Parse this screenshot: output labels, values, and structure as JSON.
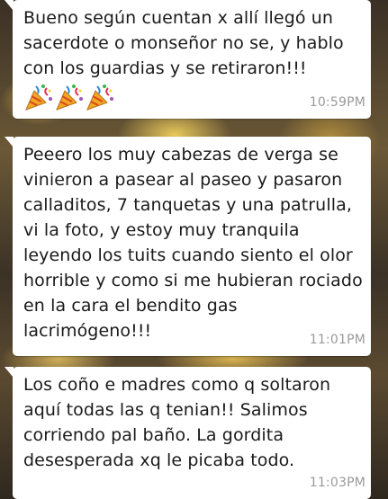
{
  "messages": [
    {
      "text": "Bueno según cuentan x allí llegó un sacerdote o monseñor no se, y hablo con los guardias y se retiraron!!!",
      "emojis": [
        "party-popper-icon",
        "party-popper-icon",
        "party-popper-icon"
      ],
      "time": "10:59PM"
    },
    {
      "text": "Peeero los muy cabezas de verga se vinieron a pasear al paseo y pasaron calladitos, 7 tanquetas y una patrulla, vi la foto, y estoy muy tranquila leyendo los tuits cuando siento el olor horrible y como si me hubieran rociado en la cara el bendito gas lacrimógeno!!!",
      "time": "11:01PM"
    },
    {
      "text": "Los coño e madres como q soltaron aquí todas las q tenian!! Salimos corriendo pal baño. La gordita desesperada xq le picaba todo.",
      "time": "11:03PM"
    }
  ],
  "colors": {
    "bubble": "#ffffff",
    "text": "#1a1a1a",
    "timestamp": "#9a9a9a"
  }
}
